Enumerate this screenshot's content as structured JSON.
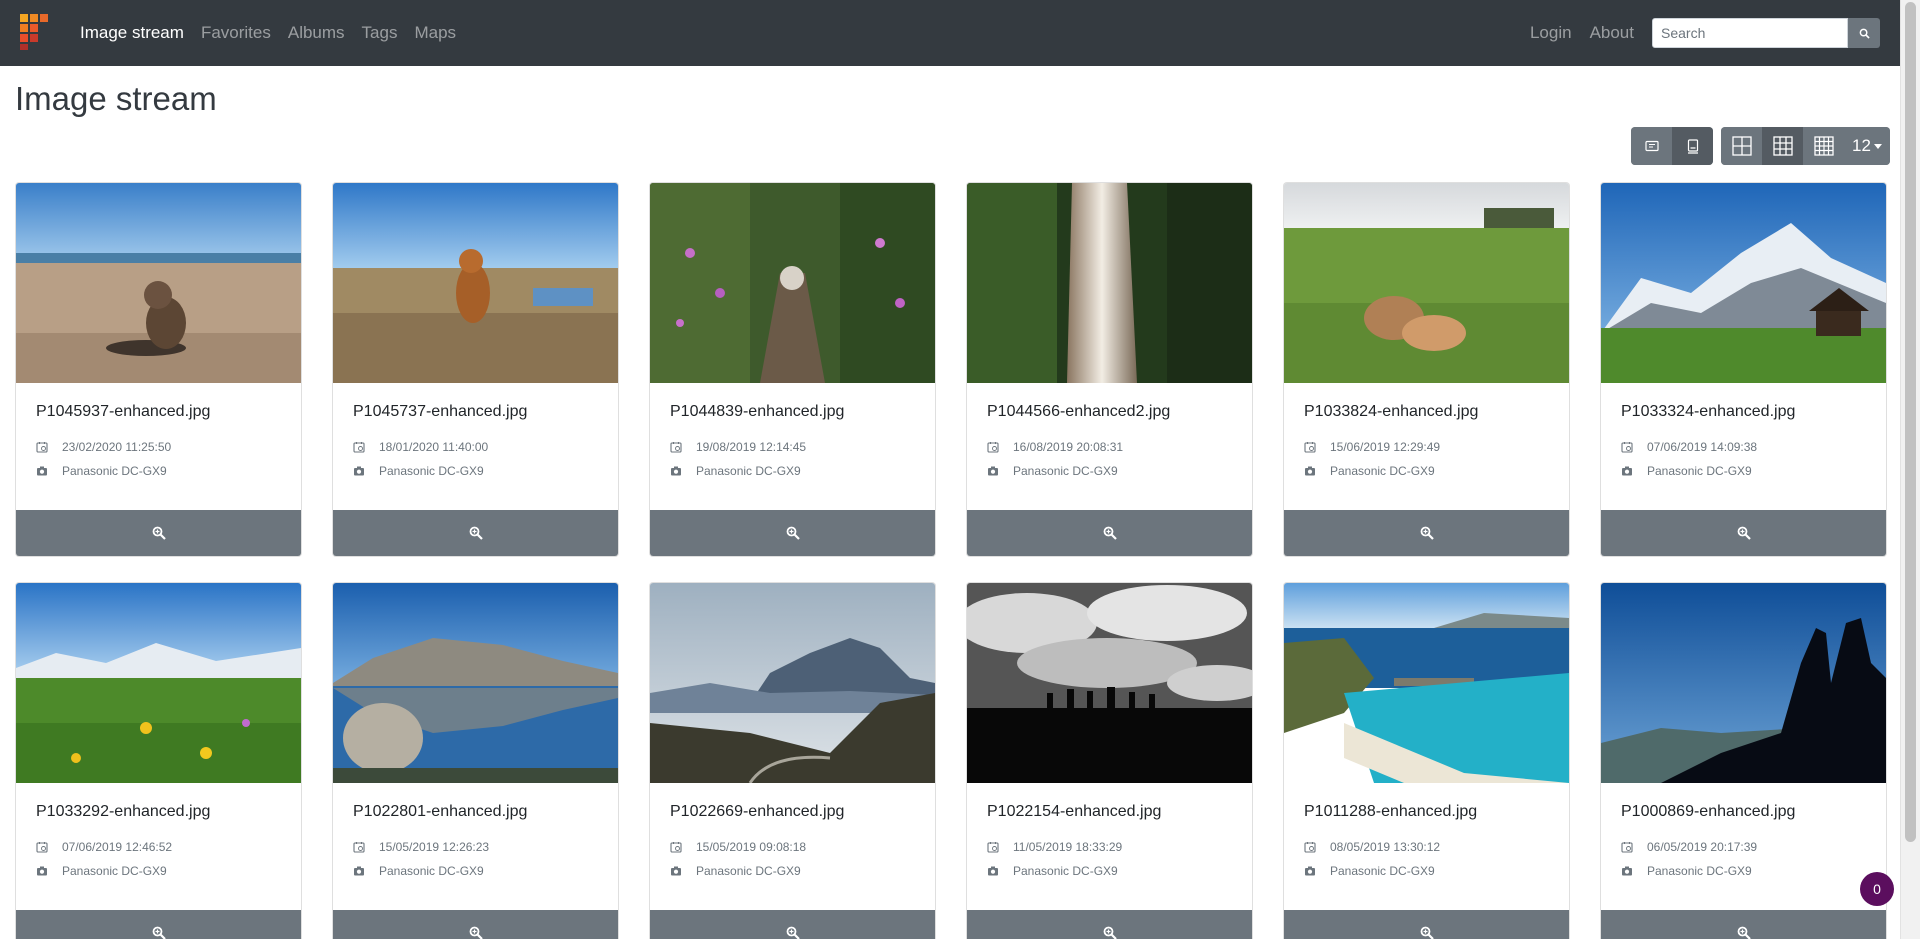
{
  "nav": {
    "items": [
      "Image stream",
      "Favorites",
      "Albums",
      "Tags",
      "Maps"
    ],
    "login": "Login",
    "about": "About",
    "search_placeholder": "Search"
  },
  "page": {
    "title": "Image stream"
  },
  "toolbar": {
    "page_size": "12"
  },
  "photos": [
    {
      "filename": "P1045937-enhanced.jpg",
      "date": "23/02/2020 11:25:50",
      "camera": "Panasonic DC-GX9"
    },
    {
      "filename": "P1045737-enhanced.jpg",
      "date": "18/01/2020 11:40:00",
      "camera": "Panasonic DC-GX9"
    },
    {
      "filename": "P1044839-enhanced.jpg",
      "date": "19/08/2019 12:14:45",
      "camera": "Panasonic DC-GX9"
    },
    {
      "filename": "P1044566-enhanced2.jpg",
      "date": "16/08/2019 20:08:31",
      "camera": "Panasonic DC-GX9"
    },
    {
      "filename": "P1033824-enhanced.jpg",
      "date": "15/06/2019 12:29:49",
      "camera": "Panasonic DC-GX9"
    },
    {
      "filename": "P1033324-enhanced.jpg",
      "date": "07/06/2019 14:09:38",
      "camera": "Panasonic DC-GX9"
    },
    {
      "filename": "P1033292-enhanced.jpg",
      "date": "07/06/2019 12:46:52",
      "camera": "Panasonic DC-GX9"
    },
    {
      "filename": "P1022801-enhanced.jpg",
      "date": "15/05/2019 12:26:23",
      "camera": "Panasonic DC-GX9"
    },
    {
      "filename": "P1022669-enhanced.jpg",
      "date": "15/05/2019 09:08:18",
      "camera": "Panasonic DC-GX9"
    },
    {
      "filename": "P1022154-enhanced.jpg",
      "date": "11/05/2019 18:33:29",
      "camera": "Panasonic DC-GX9"
    },
    {
      "filename": "P1011288-enhanced.jpg",
      "date": "08/05/2019 13:30:12",
      "camera": "Panasonic DC-GX9"
    },
    {
      "filename": "P1000869-enhanced.jpg",
      "date": "06/05/2019 20:17:39",
      "camera": "Panasonic DC-GX9"
    }
  ],
  "badge": {
    "count": "0"
  },
  "colors": {
    "navbar": "#343a40",
    "secondary": "#6c757d",
    "badge": "#5b0e5e"
  }
}
